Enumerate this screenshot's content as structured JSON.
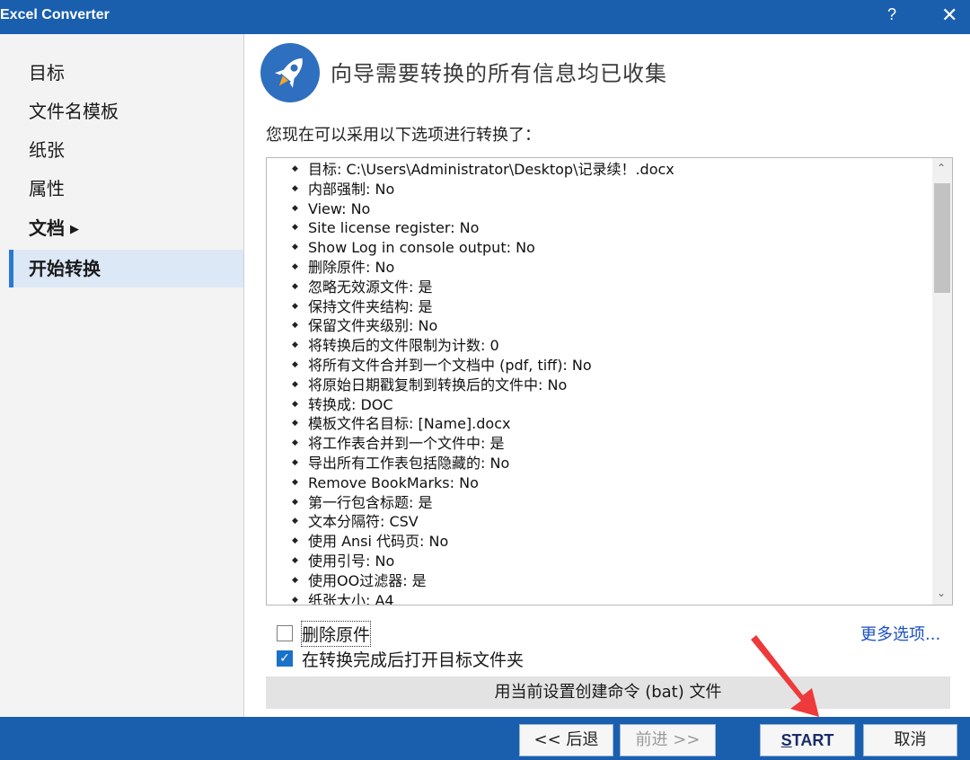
{
  "window": {
    "title": "Excel Converter",
    "help_label": "?",
    "close_label": "✕"
  },
  "sidebar": {
    "items": [
      {
        "label": "目标"
      },
      {
        "label": "文件名模板"
      },
      {
        "label": "纸张"
      },
      {
        "label": "属性"
      },
      {
        "label": "文档",
        "has_submenu": true
      },
      {
        "label": "开始转换",
        "active": true
      }
    ]
  },
  "main": {
    "heading": "向导需要转换的所有信息均已收集",
    "intro": "您现在可以采用以下选项进行转换了：",
    "summary_items": [
      "目标: C:\\Users\\Administrator\\Desktop\\记录续！.docx",
      "内部强制: No",
      "View: No",
      "Site license register: No",
      "Show Log in console output: No",
      "删除原件: No",
      "忽略无效源文件: 是",
      "保持文件夹结构: 是",
      "保留文件夹级别: No",
      "将转换后的文件限制为计数: 0",
      "将所有文件合并到一个文档中 (pdf, tiff): No",
      "将原始日期戳复制到转换后的文件中: No",
      "转换成: DOC",
      "模板文件名目标: [Name].docx",
      "将工作表合并到一个文件中: 是",
      "导出所有工作表包括隐藏的: No",
      "Remove BookMarks: No",
      "第一行包含标题: 是",
      "文本分隔符: CSV",
      "使用 Ansi 代码页: No",
      "使用引号: No",
      "使用OO过滤器: 是",
      "纸张大小: A4"
    ],
    "options": {
      "delete_original": {
        "label": "删除原件",
        "checked": false
      },
      "open_target_folder": {
        "label": "在转换完成后打开目标文件夹",
        "checked": true
      }
    },
    "more_options_label": "更多选项...",
    "bat_button_label": "用当前设置创建命令 (bat) 文件"
  },
  "footer": {
    "back_label": "<< 后退",
    "next_label": "前进 >>",
    "start_label_first": "S",
    "start_label_rest": "TART",
    "cancel_label": "取消"
  },
  "colors": {
    "titlebar": "#1a5fae",
    "accent": "#2a7ad5",
    "link": "#1a4fc4",
    "annotation_arrow": "#ee3a3a"
  },
  "icons": {
    "hero": "rocket-icon",
    "submenu": "triangle-right-icon",
    "check": "check-icon"
  }
}
